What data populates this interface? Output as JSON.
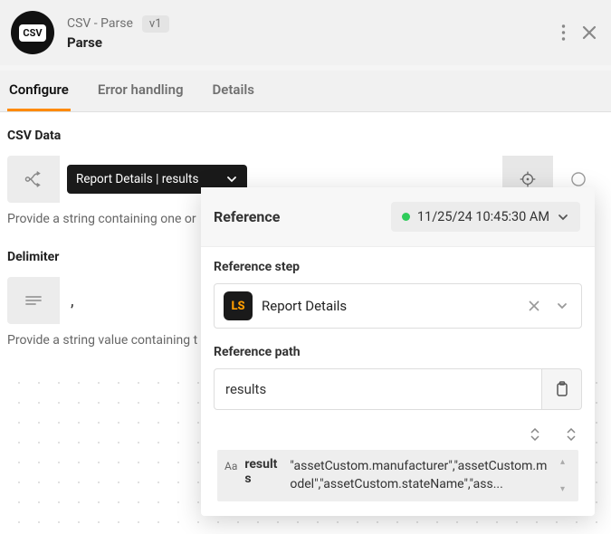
{
  "header": {
    "icon_text": "CSV",
    "title": "CSV - Parse",
    "version": "v1",
    "subtitle": "Parse"
  },
  "tabs": {
    "configure": "Configure",
    "error_handling": "Error handling",
    "details": "Details"
  },
  "csv_data": {
    "label": "CSV Data",
    "chip_text": "Report Details | results",
    "help": "Provide a string containing one or"
  },
  "delimiter": {
    "label": "Delimiter",
    "value": ",",
    "help": "Provide a string value containing t"
  },
  "popover": {
    "title": "Reference",
    "timestamp": "11/25/24 10:45:30 AM",
    "ref_step_label": "Reference step",
    "step_name": "Report Details",
    "step_logo": "LS",
    "ref_path_label": "Reference path",
    "path_value": "results",
    "result_key": "results",
    "result_value": "\"assetCustom.manufacturer\",\"assetCustom.model\",\"assetCustom.stateName\",\"ass..."
  }
}
